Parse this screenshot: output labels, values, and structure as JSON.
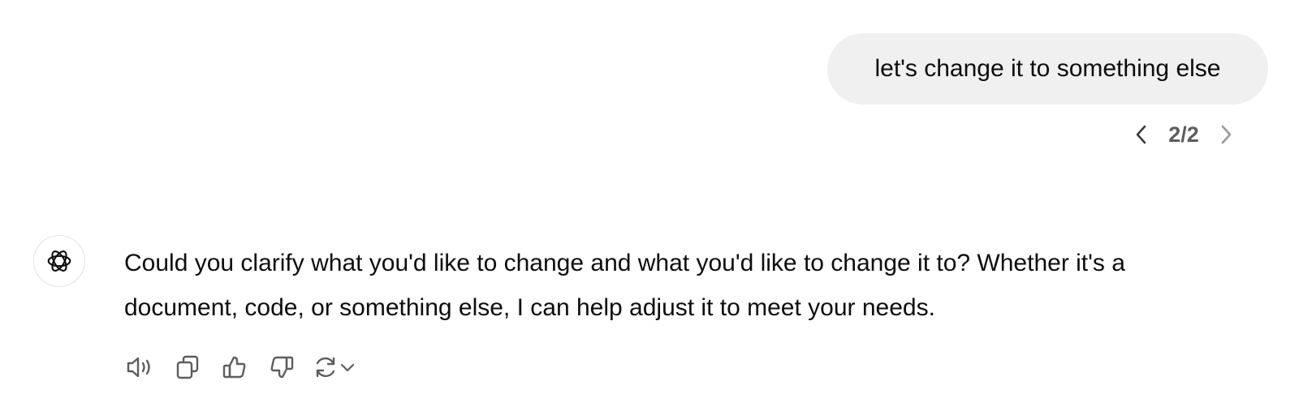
{
  "user_message": {
    "text": "let's change it to something else"
  },
  "pager": {
    "current_total": "2/2",
    "prev_icon": "chevron-left-icon",
    "next_icon": "chevron-right-icon"
  },
  "assistant": {
    "avatar_icon": "openai-logo-icon",
    "message": "Could you clarify what you'd like to change and what you'd like to change it to? Whether it's a document, code, or something else, I can help adjust it to meet your needs."
  },
  "actions": [
    {
      "icon": "speaker-icon"
    },
    {
      "icon": "copy-icon"
    },
    {
      "icon": "thumbs-up-icon"
    },
    {
      "icon": "thumbs-down-icon"
    },
    {
      "icon": "regenerate-icon"
    }
  ],
  "colors": {
    "user_bubble_bg": "#f0f0f0",
    "text": "#0d0d0d",
    "muted": "#5d5d5d"
  }
}
